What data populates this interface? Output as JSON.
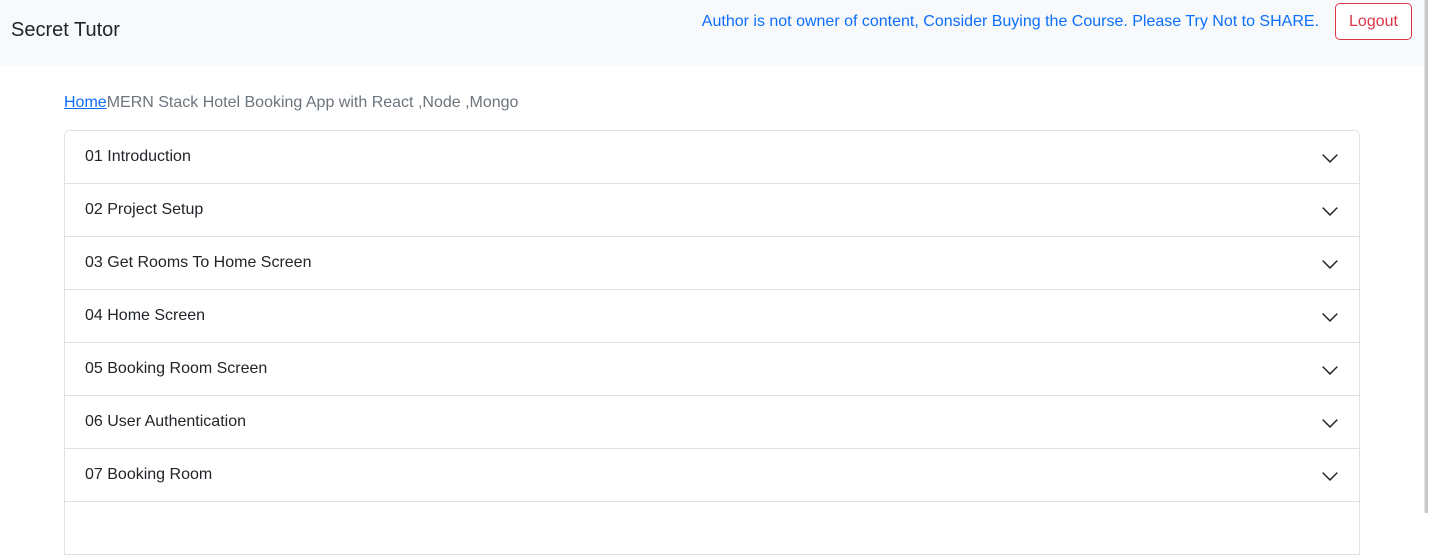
{
  "navbar": {
    "brand": "Secret Tutor",
    "notice": "Author is not owner of content, Consider Buying the Course. Please Try Not to SHARE.",
    "logout_label": "Logout"
  },
  "breadcrumb": {
    "home": "Home",
    "current": "MERN Stack Hotel Booking App with React ,Node ,Mongo"
  },
  "accordion": {
    "items": [
      {
        "label": "01 Introduction",
        "icon": "chevron-down-icon"
      },
      {
        "label": "02 Project Setup",
        "icon": "chevron-down-icon"
      },
      {
        "label": "03 Get Rooms To Home Screen",
        "icon": "chevron-down-icon"
      },
      {
        "label": "04 Home Screen",
        "icon": "chevron-down-icon"
      },
      {
        "label": "05 Booking Room Screen",
        "icon": "chevron-down-icon"
      },
      {
        "label": "06 User Authentication",
        "icon": "chevron-down-icon"
      },
      {
        "label": "07 Booking Room",
        "icon": "chevron-down-icon"
      },
      {
        "label": "",
        "icon": "chevron-down-icon"
      }
    ]
  },
  "colors": {
    "navbar_bg": "#f8f9fa",
    "notice": "#0d6efd",
    "logout": "#dc3545",
    "link": "#0d6efd",
    "muted": "#6c757d",
    "border": "#dee2e6"
  }
}
